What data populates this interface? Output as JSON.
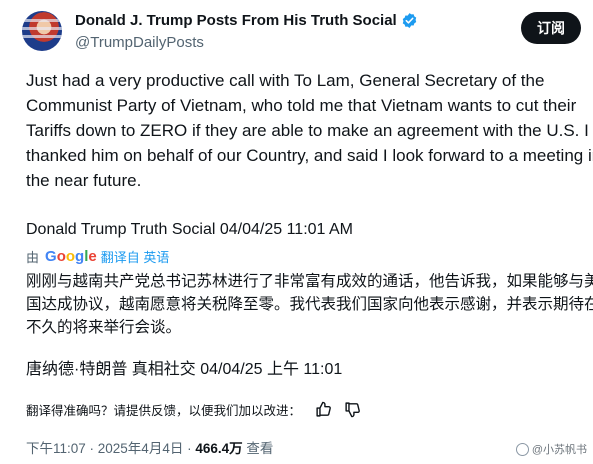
{
  "author": {
    "display_name": "Donald J. Trump Posts From His Truth Social",
    "handle": "@TrumpDailyPosts",
    "verified": true
  },
  "subscribe_label": "订阅",
  "post_text": "Just had a very productive call with To Lam, General Secretary of the Communist Party of Vietnam, who told me that Vietnam wants to cut their Tariffs down to ZERO if they are able to make an agreement with the U.S. I thanked him on behalf of our Country, and said I look forward to a meeting in the near future.",
  "source_line": "Donald Trump Truth Social 04/04/25 11:01 AM",
  "translation_bar": {
    "prefix": "由",
    "google_letters": [
      "G",
      "o",
      "o",
      "g",
      "l",
      "e"
    ],
    "link_text": "翻译自 英语"
  },
  "translated_text": "刚刚与越南共产党总书记苏林进行了非常富有成效的通话，他告诉我，如果能够与美国达成协议，越南愿意将关税降至零。我代表我们国家向他表示感谢，并表示期待在不久的将来举行会谈。",
  "translated_source": "唐纳德·特朗普 真相社交 04/04/25 上午 11:01",
  "feedback": {
    "question": "翻译得准确吗？请提供反馈，以便我们加以改进：",
    "thumbs_up_icon": "thumbs-up-icon",
    "thumbs_down_icon": "thumbs-down-icon"
  },
  "meta": {
    "time_date": "下午11:07 · 2025年4月4日 ·",
    "views_count": "466.4万",
    "views_label": "查看"
  },
  "watermark": "@小苏帆书",
  "colors": {
    "accent": "#1d9bf0",
    "text": "#0f1419",
    "muted": "#536471",
    "button": "#0f1419"
  }
}
